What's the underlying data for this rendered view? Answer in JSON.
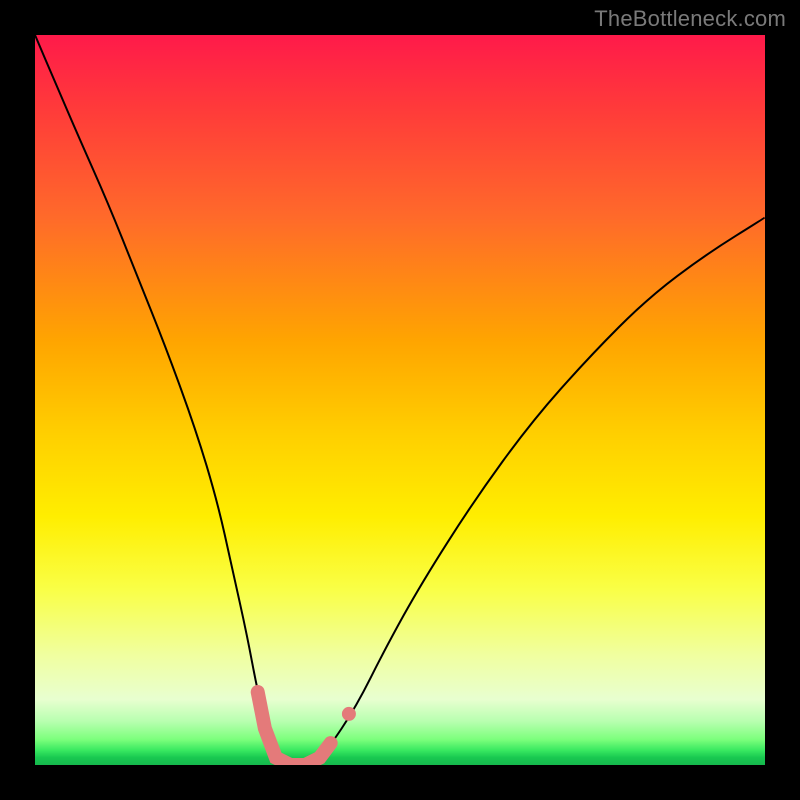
{
  "watermark": "TheBottleneck.com",
  "colors": {
    "frame": "#000000",
    "curve": "#000000",
    "highlight": "#e47a7a",
    "gradient_top": "#ff1a4a",
    "gradient_bottom": "#16b84d"
  },
  "chart_data": {
    "type": "line",
    "title": "",
    "xlabel": "",
    "ylabel": "",
    "xlim": [
      0,
      100
    ],
    "ylim": [
      0,
      100
    ],
    "grid": false,
    "legend": false,
    "annotations": [
      "TheBottleneck.com"
    ],
    "series": [
      {
        "name": "bottleneck-curve",
        "x": [
          0,
          3,
          6,
          10,
          14,
          18,
          22,
          25,
          27,
          29,
          30.5,
          32,
          34,
          36,
          38,
          40,
          44,
          48,
          53,
          60,
          68,
          76,
          84,
          92,
          100
        ],
        "y": [
          100,
          93,
          86,
          77,
          67,
          57,
          46,
          36,
          27,
          18,
          10,
          4,
          0,
          0,
          0,
          2,
          8,
          16,
          25,
          36,
          47,
          56,
          64,
          70,
          75
        ]
      }
    ],
    "highlight_region": {
      "name": "optimal-range",
      "points": [
        {
          "x": 30.5,
          "y": 10
        },
        {
          "x": 31.5,
          "y": 5
        },
        {
          "x": 33,
          "y": 1
        },
        {
          "x": 35,
          "y": 0
        },
        {
          "x": 37,
          "y": 0
        },
        {
          "x": 39,
          "y": 1
        },
        {
          "x": 40.5,
          "y": 3
        }
      ],
      "extra_dot": {
        "x": 43,
        "y": 7
      }
    }
  }
}
